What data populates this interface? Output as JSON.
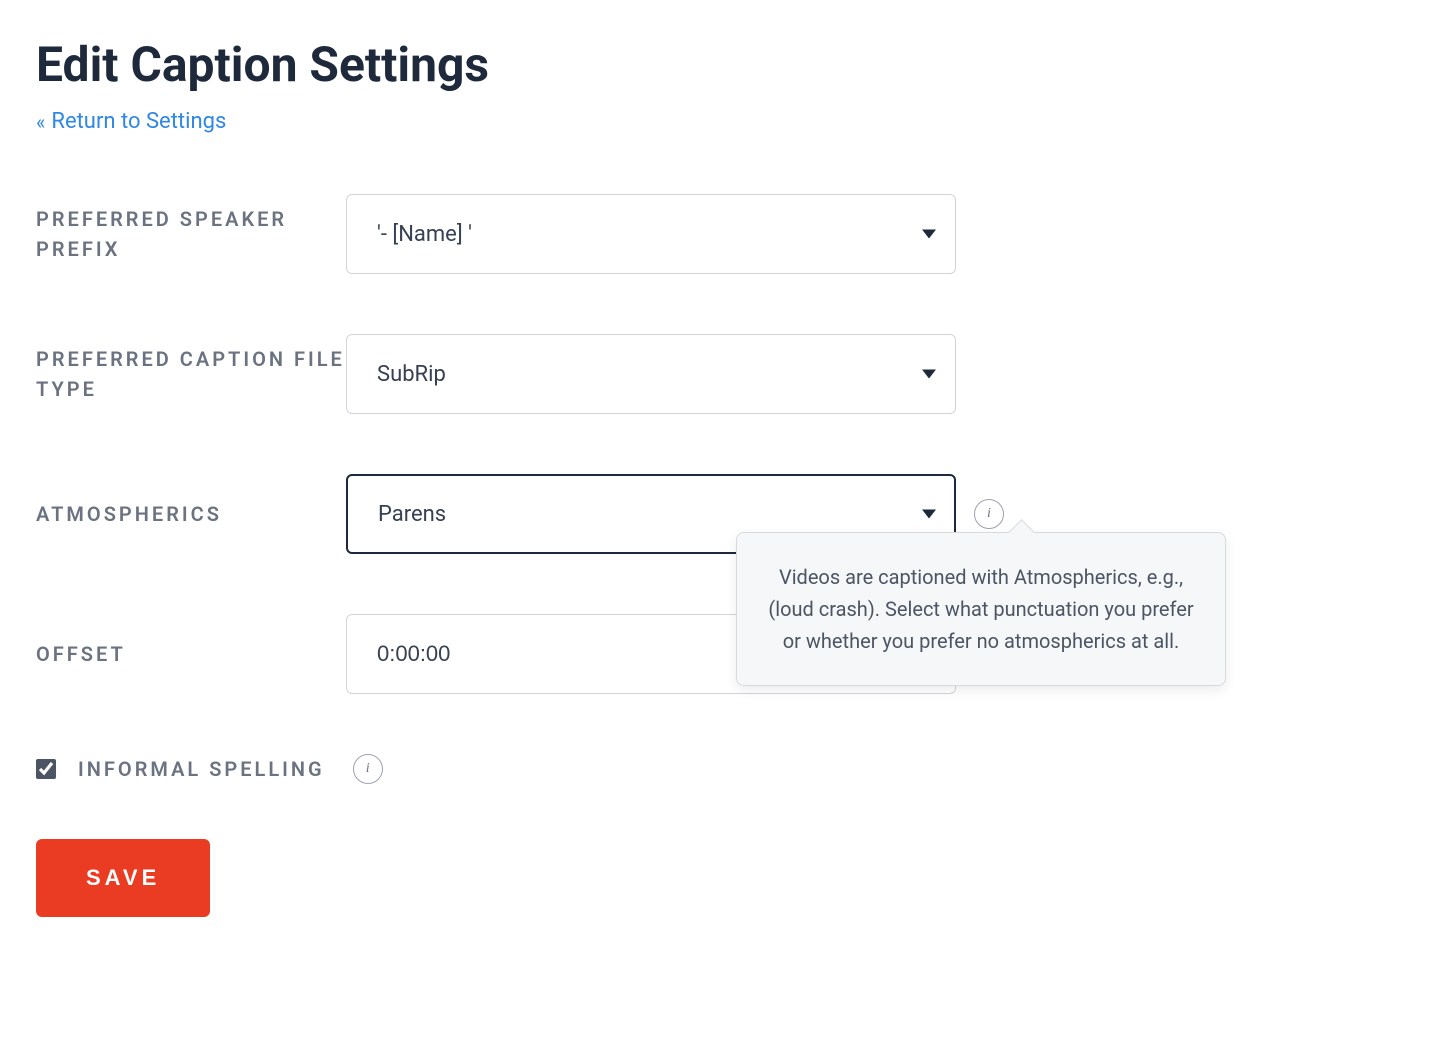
{
  "page": {
    "title": "Edit Caption Settings",
    "return_link": "Return to Settings"
  },
  "fields": {
    "speaker_prefix": {
      "label": "PREFERRED SPEAKER PREFIX",
      "value": "'- [Name] '"
    },
    "caption_file_type": {
      "label": "PREFERRED CAPTION FILE TYPE",
      "value": "SubRip"
    },
    "atmospherics": {
      "label": "ATMOSPHERICS",
      "value": "Parens",
      "tooltip": "Videos are captioned with Atmospherics, e.g., (loud crash). Select what punctuation you prefer or whether you prefer no atmospherics at all."
    },
    "offset": {
      "label": "OFFSET",
      "value": "0:00:00"
    },
    "informal_spelling": {
      "label": "INFORMAL SPELLING",
      "checked": true
    }
  },
  "buttons": {
    "save": "SAVE"
  }
}
